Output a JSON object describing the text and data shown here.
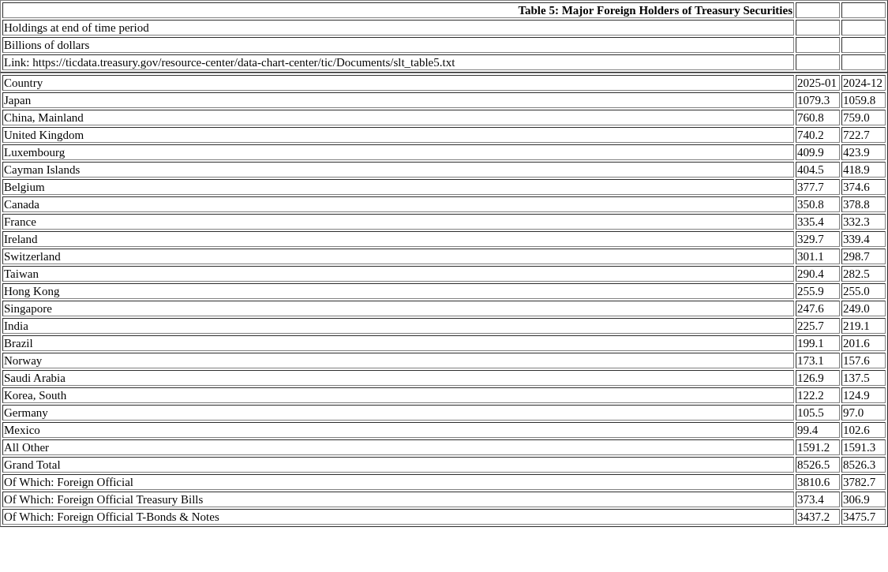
{
  "title": "Table 5: Major Foreign Holders of Treasury Securities",
  "notes": [
    "Holdings at end of time period",
    "Billions of dollars",
    "Link: https://ticdata.treasury.gov/resource-center/data-chart-center/tic/Documents/slt_table5.txt"
  ],
  "table": {
    "columns": [
      "Country",
      "2025-01",
      "2024-12"
    ],
    "rows": [
      [
        "Japan",
        "1079.3",
        "1059.8"
      ],
      [
        "China, Mainland",
        "760.8",
        "759.0"
      ],
      [
        "United Kingdom",
        "740.2",
        "722.7"
      ],
      [
        "Luxembourg",
        "409.9",
        "423.9"
      ],
      [
        "Cayman Islands",
        "404.5",
        "418.9"
      ],
      [
        "Belgium",
        "377.7",
        "374.6"
      ],
      [
        "Canada",
        "350.8",
        "378.8"
      ],
      [
        "France",
        "335.4",
        "332.3"
      ],
      [
        "Ireland",
        "329.7",
        "339.4"
      ],
      [
        "Switzerland",
        "301.1",
        "298.7"
      ],
      [
        "Taiwan",
        "290.4",
        "282.5"
      ],
      [
        "Hong Kong",
        "255.9",
        "255.0"
      ],
      [
        "Singapore",
        "247.6",
        "249.0"
      ],
      [
        "India",
        "225.7",
        "219.1"
      ],
      [
        "Brazil",
        "199.1",
        "201.6"
      ],
      [
        "Norway",
        "173.1",
        "157.6"
      ],
      [
        "Saudi Arabia",
        "126.9",
        "137.5"
      ],
      [
        "Korea, South",
        "122.2",
        "124.9"
      ],
      [
        "Germany",
        "105.5",
        "97.0"
      ],
      [
        "Mexico",
        "99.4",
        "102.6"
      ],
      [
        "All Other",
        "1591.2",
        "1591.3"
      ],
      [
        "Grand Total",
        "8526.5",
        "8526.3"
      ],
      [
        "Of Which: Foreign Official",
        "3810.6",
        "3782.7"
      ],
      [
        "Of Which: Foreign Official Treasury Bills",
        "373.4",
        "306.9"
      ],
      [
        "Of Which: Foreign Official T-Bonds & Notes",
        "3437.2",
        "3475.7"
      ]
    ]
  }
}
